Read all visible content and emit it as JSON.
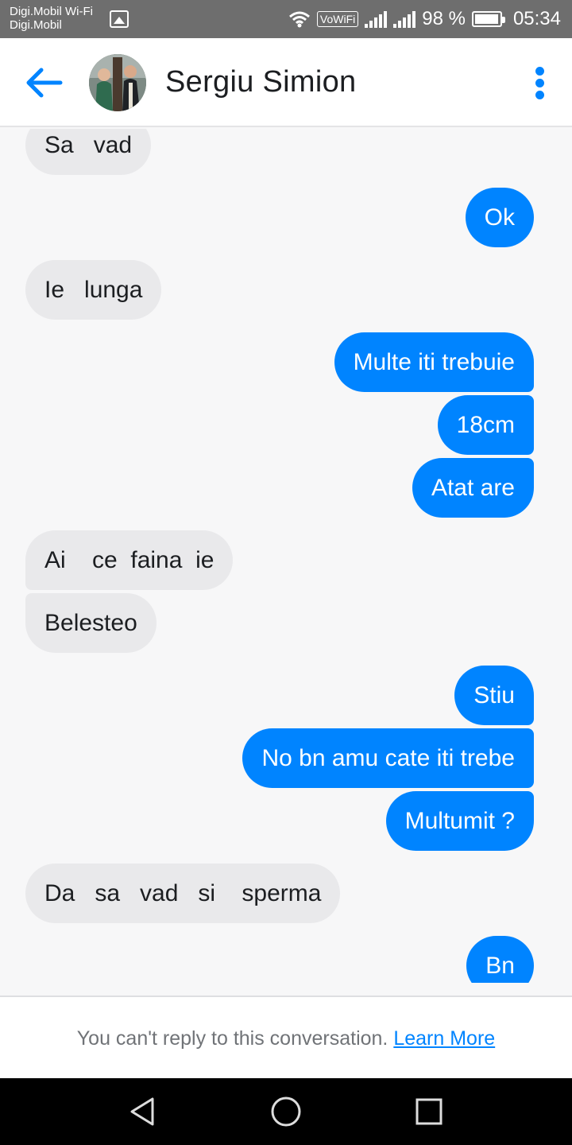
{
  "status_bar": {
    "carrier_line1": "Digi.Mobil Wi-Fi",
    "carrier_line2": "Digi.Mobil",
    "vowifi_label": "VoWiFi",
    "battery_text": "98 %",
    "time": "05:34"
  },
  "header": {
    "contact_name": "Sergiu Simion",
    "accent_color": "#0084ff"
  },
  "messages": [
    {
      "side": "incoming",
      "text": "Sa   vad"
    },
    {
      "side": "outgoing",
      "text": "Ok"
    },
    {
      "side": "incoming",
      "text": "Ie   lunga"
    },
    {
      "side": "outgoing",
      "text": "Multe iti trebuie"
    },
    {
      "side": "outgoing",
      "text": "18cm"
    },
    {
      "side": "outgoing",
      "text": "Atat are"
    },
    {
      "side": "incoming",
      "text": "Ai    ce  faina  ie"
    },
    {
      "side": "incoming",
      "text": "Belesteo"
    },
    {
      "side": "outgoing",
      "text": "Stiu"
    },
    {
      "side": "outgoing",
      "text": "No bn amu cate iti trebe"
    },
    {
      "side": "outgoing",
      "text": "Multumit ?"
    },
    {
      "side": "incoming",
      "text": "Da   sa   vad   si    sperma"
    },
    {
      "side": "outgoing",
      "text": "Bn"
    }
  ],
  "footer": {
    "notice": "You can't reply to this conversation.",
    "link_label": "Learn More"
  },
  "nav": {
    "back_icon": "triangle-back-icon",
    "home_icon": "circle-home-icon",
    "recents_icon": "square-recents-icon"
  }
}
